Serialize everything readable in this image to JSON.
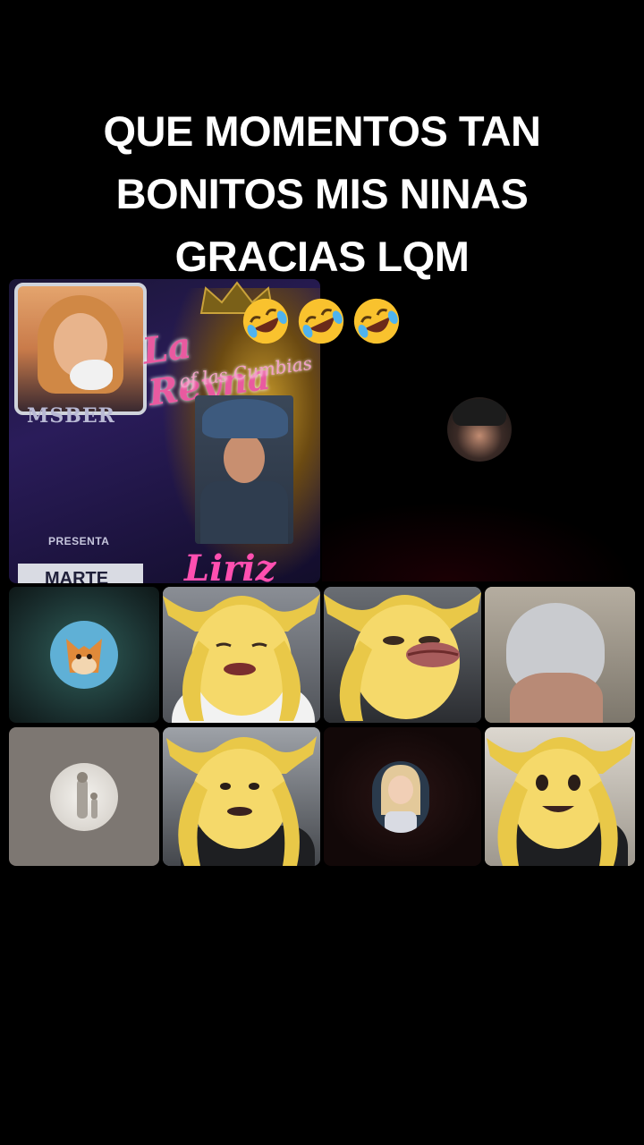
{
  "caption": {
    "lines": [
      "QUE MOMENTOS TAN",
      "BONITOS MIS NINAS",
      "GRACIAS LQM"
    ],
    "emoji_icon": "rolling-on-floor-laughing-emoji",
    "emoji_count": 3
  },
  "host_poster": {
    "logo_text": "MSBER",
    "title": "La Reyna",
    "subtitle": "of las Cumbias",
    "presenta": "PRESENTA",
    "day": "MARTE",
    "name": "Liriz"
  },
  "participants": [
    {
      "tile": "cohost-avatar",
      "type": "avatar",
      "icon": "cowboy-hat-woman"
    },
    {
      "tile": "fox-avatar",
      "type": "avatar",
      "icon": "fox-icon"
    },
    {
      "tile": "banana-filter-1",
      "type": "video",
      "icon": "banana-face-filter"
    },
    {
      "tile": "banana-filter-2",
      "type": "video",
      "icon": "banana-face-filter"
    },
    {
      "tile": "towel-video",
      "type": "video",
      "icon": "person-in-towel"
    },
    {
      "tile": "jesus-avatar",
      "type": "avatar",
      "icon": "walking-figures"
    },
    {
      "tile": "banana-filter-3",
      "type": "video",
      "icon": "banana-face-filter"
    },
    {
      "tile": "doll-avatar",
      "type": "avatar",
      "icon": "doll-avatar"
    },
    {
      "tile": "banana-filter-4",
      "type": "video",
      "icon": "banana-face-filter"
    }
  ],
  "colors": {
    "background": "#000000",
    "caption": "#ffffff",
    "banana": "#f5d96a"
  }
}
